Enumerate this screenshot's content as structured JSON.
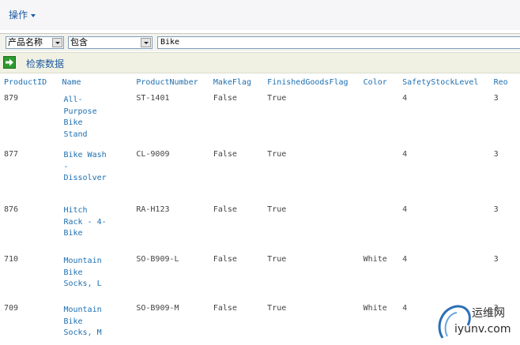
{
  "menu": {
    "label": "操作"
  },
  "filter": {
    "field_value": "产品名称",
    "operator_value": "包含",
    "search_value": "Bike"
  },
  "search": {
    "label": "检索数据"
  },
  "table": {
    "columns": [
      "ProductID",
      "Name",
      "ProductNumber",
      "MakeFlag",
      "FinishedGoodsFlag",
      "Color",
      "SafetyStockLevel",
      "Reo"
    ],
    "rows": [
      {
        "ProductID": "879",
        "Name": "All-Purpose Bike Stand",
        "ProductNumber": "ST-1401",
        "MakeFlag": "False",
        "FinishedGoodsFlag": "True",
        "Color": "",
        "SafetyStockLevel": "4",
        "Reorder": "3"
      },
      {
        "ProductID": "877",
        "Name": "Bike Wash - Dissolver",
        "ProductNumber": "CL-9009",
        "MakeFlag": "False",
        "FinishedGoodsFlag": "True",
        "Color": "",
        "SafetyStockLevel": "4",
        "Reorder": "3"
      },
      {
        "ProductID": "876",
        "Name": "Hitch Rack - 4-Bike",
        "ProductNumber": "RA-H123",
        "MakeFlag": "False",
        "FinishedGoodsFlag": "True",
        "Color": "",
        "SafetyStockLevel": "4",
        "Reorder": "3"
      },
      {
        "ProductID": "710",
        "Name": "Mountain Bike Socks, L",
        "ProductNumber": "SO-B909-L",
        "MakeFlag": "False",
        "FinishedGoodsFlag": "True",
        "Color": "White",
        "SafetyStockLevel": "4",
        "Reorder": "3"
      },
      {
        "ProductID": "709",
        "Name": "Mountain Bike Socks, M",
        "ProductNumber": "SO-B909-M",
        "MakeFlag": "False",
        "FinishedGoodsFlag": "True",
        "Color": "White",
        "SafetyStockLevel": "4",
        "Reorder": "3"
      }
    ]
  },
  "watermark": {
    "text_cn": "运维网",
    "text_en": "iyunv.com"
  },
  "colors": {
    "link": "#1e6fb0",
    "accent_green": "#2e9a2e"
  }
}
